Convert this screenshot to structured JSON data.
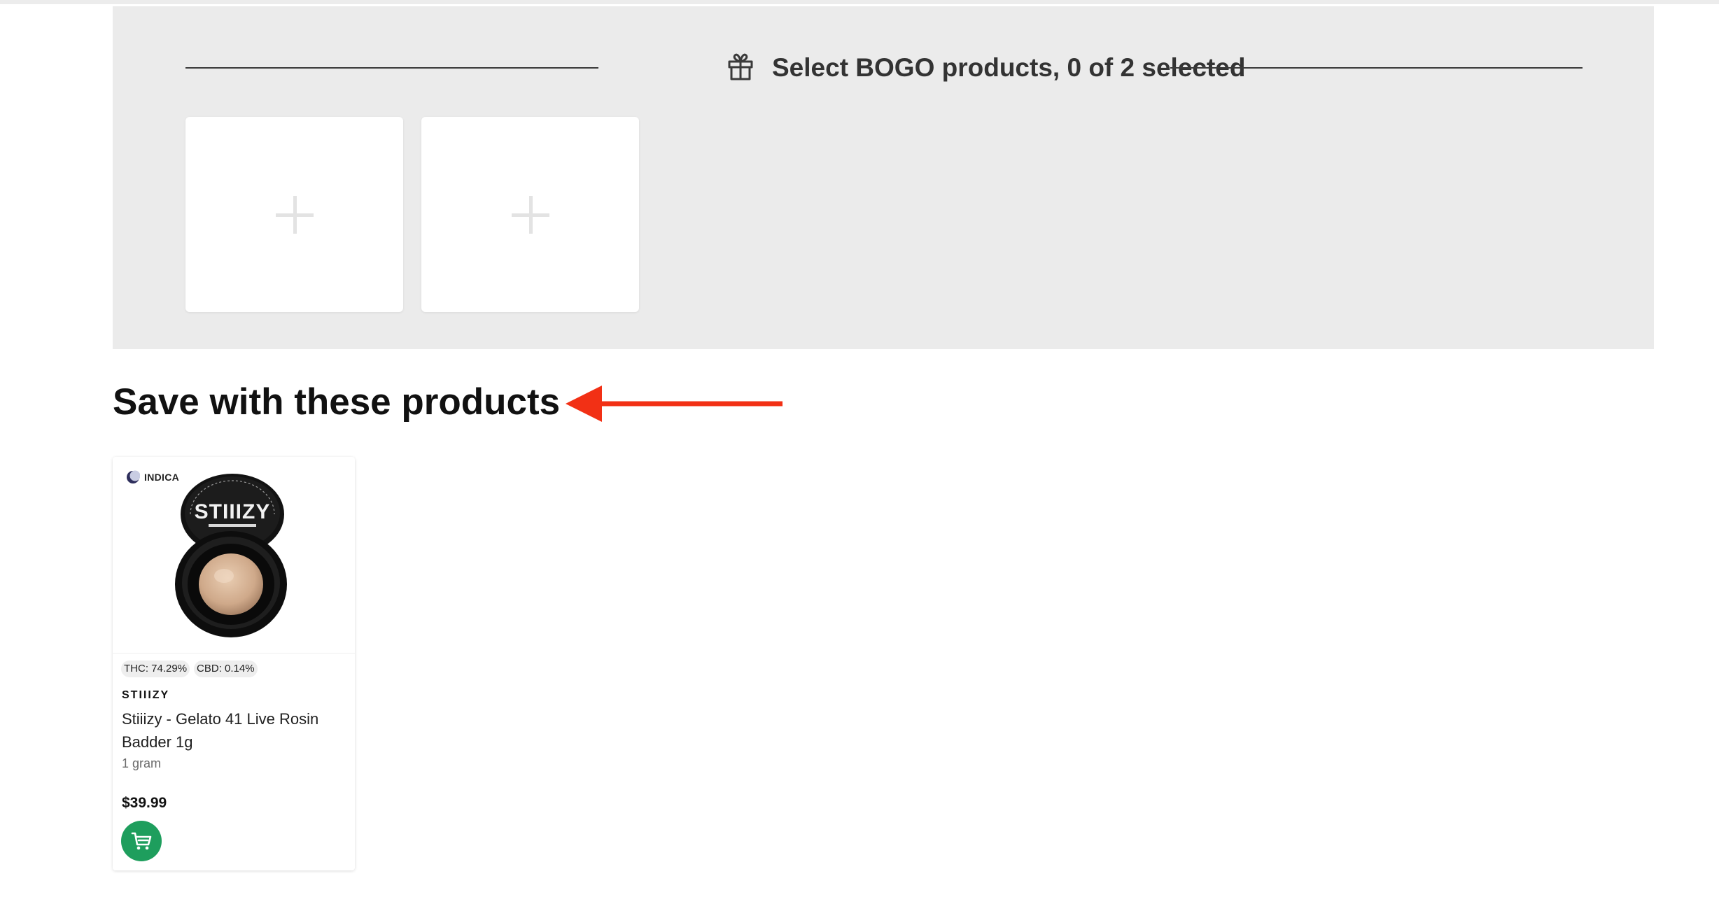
{
  "bogo": {
    "title": "Select BOGO products, 0 of 2 selected",
    "icon": "gift-icon",
    "slots": [
      {
        "icon": "plus-icon"
      },
      {
        "icon": "plus-icon"
      }
    ]
  },
  "section": {
    "title": "Save with these products",
    "annotation_color": "#f23015"
  },
  "product": {
    "strain": "INDICA",
    "strain_icon": "moon-icon",
    "image_brand_text": "STIIIZY",
    "thc": "THC: 74.29%",
    "cbd": "CBD: 0.14%",
    "brand": "STIIIZY",
    "name": "Stiiizy - Gelato 41 Live Rosin Badder 1g",
    "weight": "1 gram",
    "price": "$39.99",
    "cart_icon": "cart-icon",
    "cart_color": "#1e9e5d"
  }
}
